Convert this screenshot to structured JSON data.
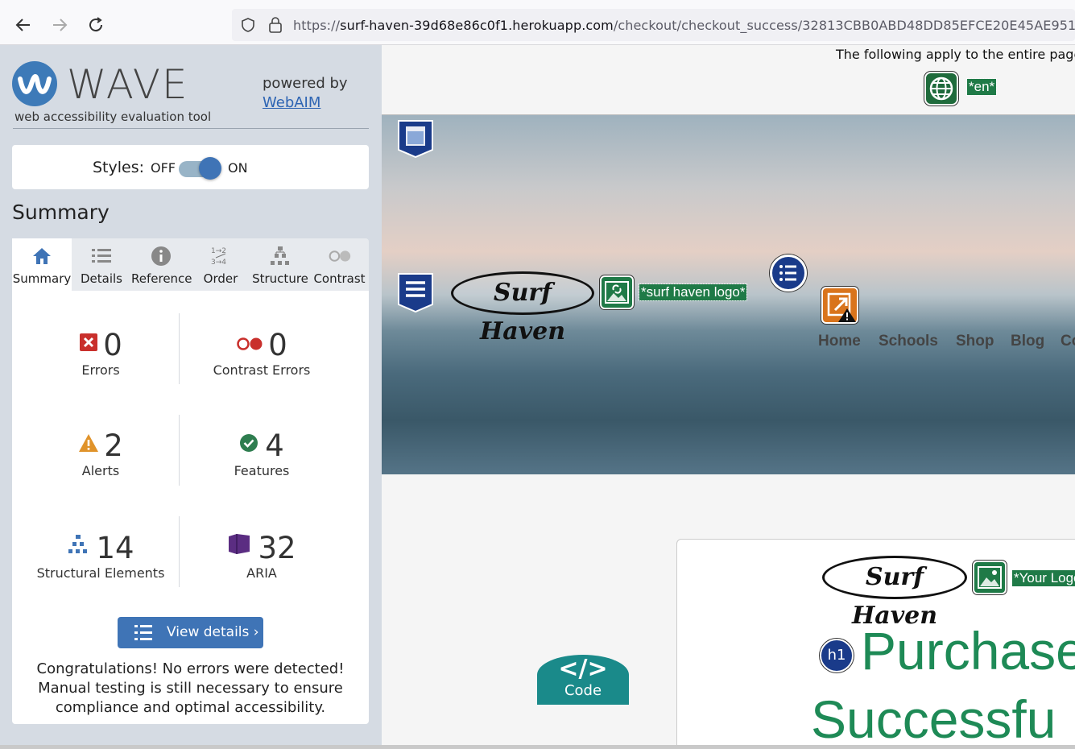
{
  "browser": {
    "url_scheme": "https://",
    "url_host": "surf-haven-39d68e86c0f1.herokuapp.com",
    "url_path": "/checkout/checkout_success/32813CBB0ABD48DD85EFCE20E45AE951"
  },
  "wave": {
    "title": "WAVE",
    "subtitle": "web accessibility evaluation tool",
    "powered_by": "powered by",
    "webaim_link": "WebAIM",
    "styles_label": "Styles:",
    "styles_off": "OFF",
    "styles_on": "ON",
    "styles_state": "on",
    "summary_heading": "Summary",
    "tabs": [
      {
        "label": "Summary",
        "icon": "home-icon"
      },
      {
        "label": "Details",
        "icon": "list-icon"
      },
      {
        "label": "Reference",
        "icon": "info-icon"
      },
      {
        "label": "Order",
        "icon": "order-icon"
      },
      {
        "label": "Structure",
        "icon": "structure-icon"
      },
      {
        "label": "Contrast",
        "icon": "contrast-icon"
      }
    ],
    "stats": {
      "errors": {
        "value": "0",
        "label": "Errors"
      },
      "contrast_errors": {
        "value": "0",
        "label": "Contrast Errors"
      },
      "alerts": {
        "value": "2",
        "label": "Alerts"
      },
      "features": {
        "value": "4",
        "label": "Features"
      },
      "structural": {
        "value": "14",
        "label": "Structural Elements"
      },
      "aria": {
        "value": "32",
        "label": "ARIA"
      }
    },
    "view_details": "View details ›",
    "congrats": "Congratulations! No errors were detected! Manual testing is still necessary to ensure compliance and optimal accessibility."
  },
  "page": {
    "apply_text": "The following apply to the entire page:",
    "lang_tag": "*en*",
    "logo_tag": "*surf haven logo*",
    "logo_text": "Surf Haven",
    "nav": [
      "Home",
      "Schools",
      "Shop",
      "Blog",
      "Co"
    ],
    "card_logo_tag": "*Your Logo",
    "h1_badge": "h1",
    "heading_line1": "Purchase",
    "heading_line2": "Successfu",
    "code_symbol": "</>",
    "code_label": "Code"
  },
  "colors": {
    "wave_blue": "#3f74b6",
    "error_red": "#c9302c",
    "alert_orange": "#e0932a",
    "feature_green": "#2e7d4f",
    "aria_purple": "#5b2d82",
    "heading_green": "#1e8a56"
  }
}
